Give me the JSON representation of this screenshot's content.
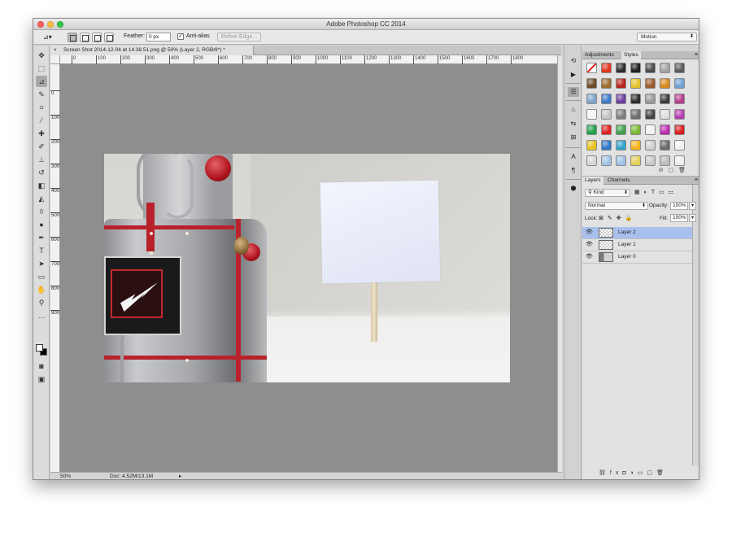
{
  "window": {
    "title": "Adobe Photoshop CC 2014"
  },
  "options_bar": {
    "tool_icon": "polygonal-lasso-icon",
    "feather_label": "Feather:",
    "feather_value": "0 px",
    "anti_alias_label": "Anti-alias",
    "anti_alias_checked": true,
    "refine_edge_label": "Refine Edge...",
    "workspace": "Motion"
  },
  "document": {
    "tab_label": "Screen Shot 2014-12-04 at 14.38.51.png @ 50% (Layer 2, RGB/8*) *",
    "ruler_ticks": [
      "0",
      "100",
      "200",
      "300",
      "400",
      "500",
      "600",
      "700",
      "800",
      "900",
      "1000",
      "1100",
      "1200",
      "1300",
      "1400",
      "1500",
      "1600",
      "1700",
      "1800"
    ],
    "vertical_ticks": [
      "0",
      "100",
      "200",
      "300",
      "400",
      "500",
      "600",
      "700",
      "800",
      "900"
    ],
    "zoom": "50%",
    "doc_size": "Doc: 4.52M/13.1M"
  },
  "adjustments_panel": {
    "tabs": [
      "Adjustments",
      "Styles"
    ],
    "active_tab": "Styles",
    "style_swatches": [
      "#ffffff",
      "#e0331c",
      "#2c2c2c",
      "#1d1d1d",
      "#4b4b4b",
      "#a3a3a3",
      "#5a5a5a",
      "#6b4a2a",
      "#9d6b2f",
      "#b7231a",
      "#e1c22a",
      "#9b5b2b",
      "#d8891f",
      "#6fa0d3",
      "#7fa5c8",
      "#3c79c7",
      "#6a3d9e",
      "#2b2b2b",
      "#9a9a9a",
      "#3a3a3a",
      "#b43d8c",
      "#f4f4f4",
      "#c6c6c6",
      "#7d7d7d",
      "#6c6c6c",
      "#424242",
      "#dddddd",
      "#b63cb3",
      "#20a04a",
      "#e02020",
      "#3da04a",
      "#7ab832",
      "#f0f0f0",
      "#bd2bb0",
      "#d81c1c",
      "#e8c21e",
      "#2f76c9",
      "#2fa2c6",
      "#f2b41c",
      "#d0d0d0",
      "#6a6a6a",
      "#f0f0f0",
      "#d7d7d7",
      "#9fc4e6",
      "#9ec2e5",
      "#e4cf57",
      "#c8c8c8",
      "#bbbbbb",
      "#eeeeee"
    ]
  },
  "layers_panel": {
    "tabs": [
      "Layers",
      "Channels"
    ],
    "active_tab": "Layers",
    "kind": "Kind",
    "blend_mode": "Normal",
    "opacity_label": "Opacity:",
    "opacity": "100%",
    "lock_label": "Lock:",
    "fill_label": "Fill:",
    "fill": "100%",
    "layers": [
      {
        "name": "Layer 2",
        "selected": true
      },
      {
        "name": "Layer 1",
        "selected": false
      },
      {
        "name": "Layer 0",
        "selected": false
      }
    ]
  }
}
